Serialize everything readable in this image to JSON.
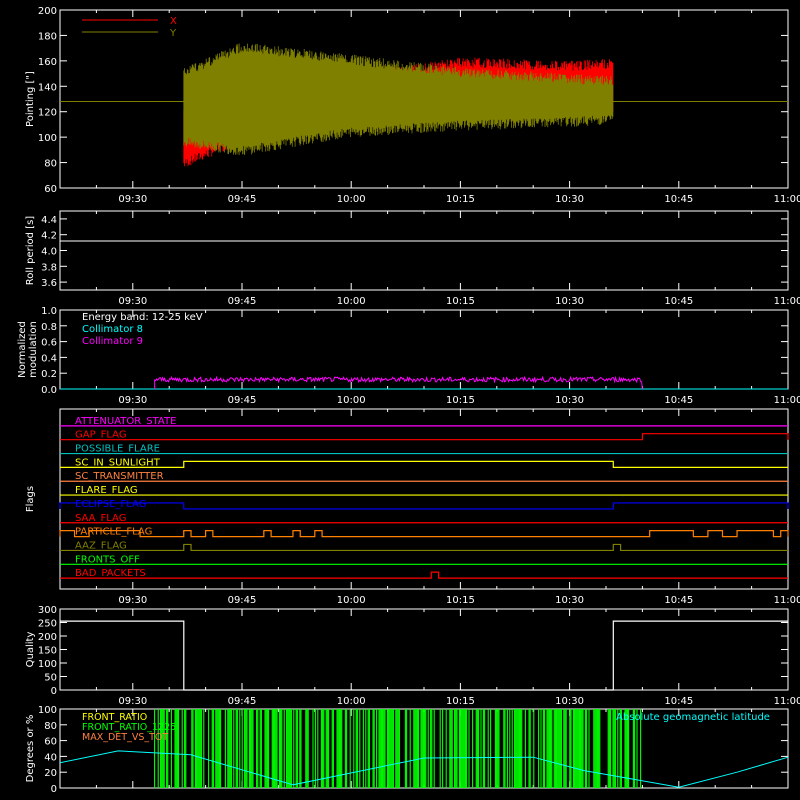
{
  "time_ticks": [
    "09:30",
    "09:45",
    "10:00",
    "10:15",
    "10:30",
    "10:45",
    "11:00"
  ],
  "chart_data": [
    {
      "type": "line",
      "ylabel": "Pointing [\"]",
      "ylim": [
        60,
        200
      ],
      "yticks": [
        60,
        80,
        100,
        120,
        140,
        160,
        180,
        200
      ],
      "legend": "top-left",
      "series": [
        {
          "name": "X",
          "color": "#ff0000",
          "baseline": 128,
          "active": [
            "09:37",
            "10:36"
          ],
          "envelope_time": [
            "09:37",
            "09:45",
            "10:00",
            "10:15",
            "10:30",
            "10:36"
          ],
          "upper": [
            125,
            135,
            150,
            163,
            160,
            162
          ],
          "lower": [
            75,
            95,
            118,
            125,
            120,
            118
          ]
        },
        {
          "name": "Y",
          "color": "#808000",
          "baseline": 128,
          "active": [
            "09:37",
            "10:36"
          ],
          "envelope_time": [
            "09:37",
            "09:45",
            "10:00",
            "10:15",
            "10:30",
            "10:36"
          ],
          "upper": [
            155,
            175,
            165,
            155,
            150,
            148
          ],
          "lower": [
            92,
            85,
            100,
            105,
            108,
            110
          ]
        }
      ]
    },
    {
      "type": "line",
      "ylabel": "Roll period [s]",
      "ylim": [
        3.5,
        4.5
      ],
      "yticks": [
        3.6,
        3.8,
        4.0,
        4.2,
        4.4
      ],
      "series": [
        {
          "color": "#ffffff",
          "x": [
            "09:20",
            "11:00"
          ],
          "y": [
            4.12,
            4.12
          ]
        }
      ]
    },
    {
      "type": "line",
      "ylabel": "Normalized modulation",
      "ylim": [
        0,
        1
      ],
      "yticks": [
        0.0,
        0.2,
        0.4,
        0.6,
        0.8,
        1.0
      ],
      "annotations": [
        {
          "text": "Energy band: 12-25 keV",
          "color": "#ffffff"
        },
        {
          "text": "Collimator 8",
          "color": "#00ffff"
        },
        {
          "text": "Collimator 9",
          "color": "#ff00ff"
        }
      ],
      "series": [
        {
          "name": "Collimator 8",
          "color": "#00ffff",
          "x": [
            "09:20",
            "11:00"
          ],
          "y": [
            0,
            0
          ]
        },
        {
          "name": "Collimator 9",
          "color": "#ff00ff",
          "active": [
            "09:33",
            "10:40"
          ],
          "mean": 0.12,
          "spread": 0.03
        }
      ]
    },
    {
      "type": "line",
      "ylabel": "Flags",
      "flags": [
        {
          "name": "ATTENUATOR_STATE",
          "color": "#ff00ff",
          "on": []
        },
        {
          "name": "GAP_FLAG",
          "color": "#ff0000",
          "on": [
            [
              "10:40",
              "11:00"
            ]
          ]
        },
        {
          "name": "POSSIBLE_FLARE",
          "color": "#00c0c0",
          "on": []
        },
        {
          "name": "SC_IN_SUNLIGHT",
          "color": "#ffff00",
          "on": [
            [
              "09:37",
              "10:36"
            ]
          ]
        },
        {
          "name": "SC_TRANSMITTER",
          "color": "#ff8040",
          "on": []
        },
        {
          "name": "FLARE_FLAG",
          "color": "#ffff00",
          "on": []
        },
        {
          "name": "ECLIPSE_FLAG",
          "color": "#0000ff",
          "on": [
            [
              "09:20",
              "09:37"
            ],
            [
              "10:36",
              "11:00"
            ]
          ]
        },
        {
          "name": "SAA_FLAG",
          "color": "#ff0000",
          "on": []
        },
        {
          "name": "PARTICLE_FLAG",
          "color": "#ff8000",
          "on": [
            [
              "09:20",
              "09:22"
            ],
            [
              "09:24",
              "09:31"
            ],
            [
              "09:37",
              "09:38"
            ],
            [
              "09:40",
              "09:41"
            ],
            [
              "09:48",
              "09:49"
            ],
            [
              "09:52",
              "09:53"
            ],
            [
              "09:55",
              "09:56"
            ],
            [
              "10:41",
              "10:47"
            ],
            [
              "10:49",
              "10:51"
            ],
            [
              "10:53",
              "10:58"
            ],
            [
              "10:59",
              "11:00"
            ]
          ]
        },
        {
          "name": "AAZ_FLAG",
          "color": "#808000",
          "on": [
            [
              "09:37",
              "09:38"
            ],
            [
              "10:36",
              "10:37"
            ]
          ]
        },
        {
          "name": "FRONTS_OFF",
          "color": "#00ff00",
          "on": []
        },
        {
          "name": "BAD_PACKETS",
          "color": "#ff0000",
          "on": [
            [
              "10:11",
              "10:12"
            ]
          ]
        }
      ]
    },
    {
      "type": "line",
      "ylabel": "Quality",
      "ylim": [
        0,
        300
      ],
      "yticks": [
        0,
        50,
        100,
        150,
        200,
        250,
        300
      ],
      "series": [
        {
          "color": "#ffffff",
          "x": [
            "09:20",
            "09:37",
            "09:37",
            "10:36",
            "10:36",
            "11:00"
          ],
          "y": [
            255,
            255,
            0,
            0,
            255,
            255
          ]
        }
      ]
    },
    {
      "type": "line",
      "ylabel": "Degrees or %",
      "ylim": [
        0,
        100
      ],
      "yticks": [
        0,
        20,
        40,
        60,
        80,
        100
      ],
      "legend": "top-left",
      "annotations": [
        {
          "text": "FRONT_RATIO",
          "color": "#ffff00"
        },
        {
          "text": "FRONT_RATIO_1225",
          "color": "#00ff00"
        },
        {
          "text": "MAX_DET_VS_TOT",
          "color": "#ff8040"
        },
        {
          "text": "Absolute geomagnetic latitude",
          "color": "#00ffff"
        }
      ],
      "series": [
        {
          "name": "FRONT_RATIO_1225",
          "color": "#00ff00",
          "kind": "bars",
          "active": [
            "09:33",
            "10:40"
          ]
        },
        {
          "name": "Absolute geomagnetic latitude",
          "color": "#00ffff",
          "x": [
            "09:20",
            "09:28",
            "09:38",
            "09:52",
            "10:10",
            "10:25",
            "10:32",
            "10:45",
            "10:53",
            "11:00"
          ],
          "y": [
            32,
            47,
            42,
            4,
            38,
            39,
            22,
            1,
            20,
            39
          ]
        }
      ]
    }
  ]
}
